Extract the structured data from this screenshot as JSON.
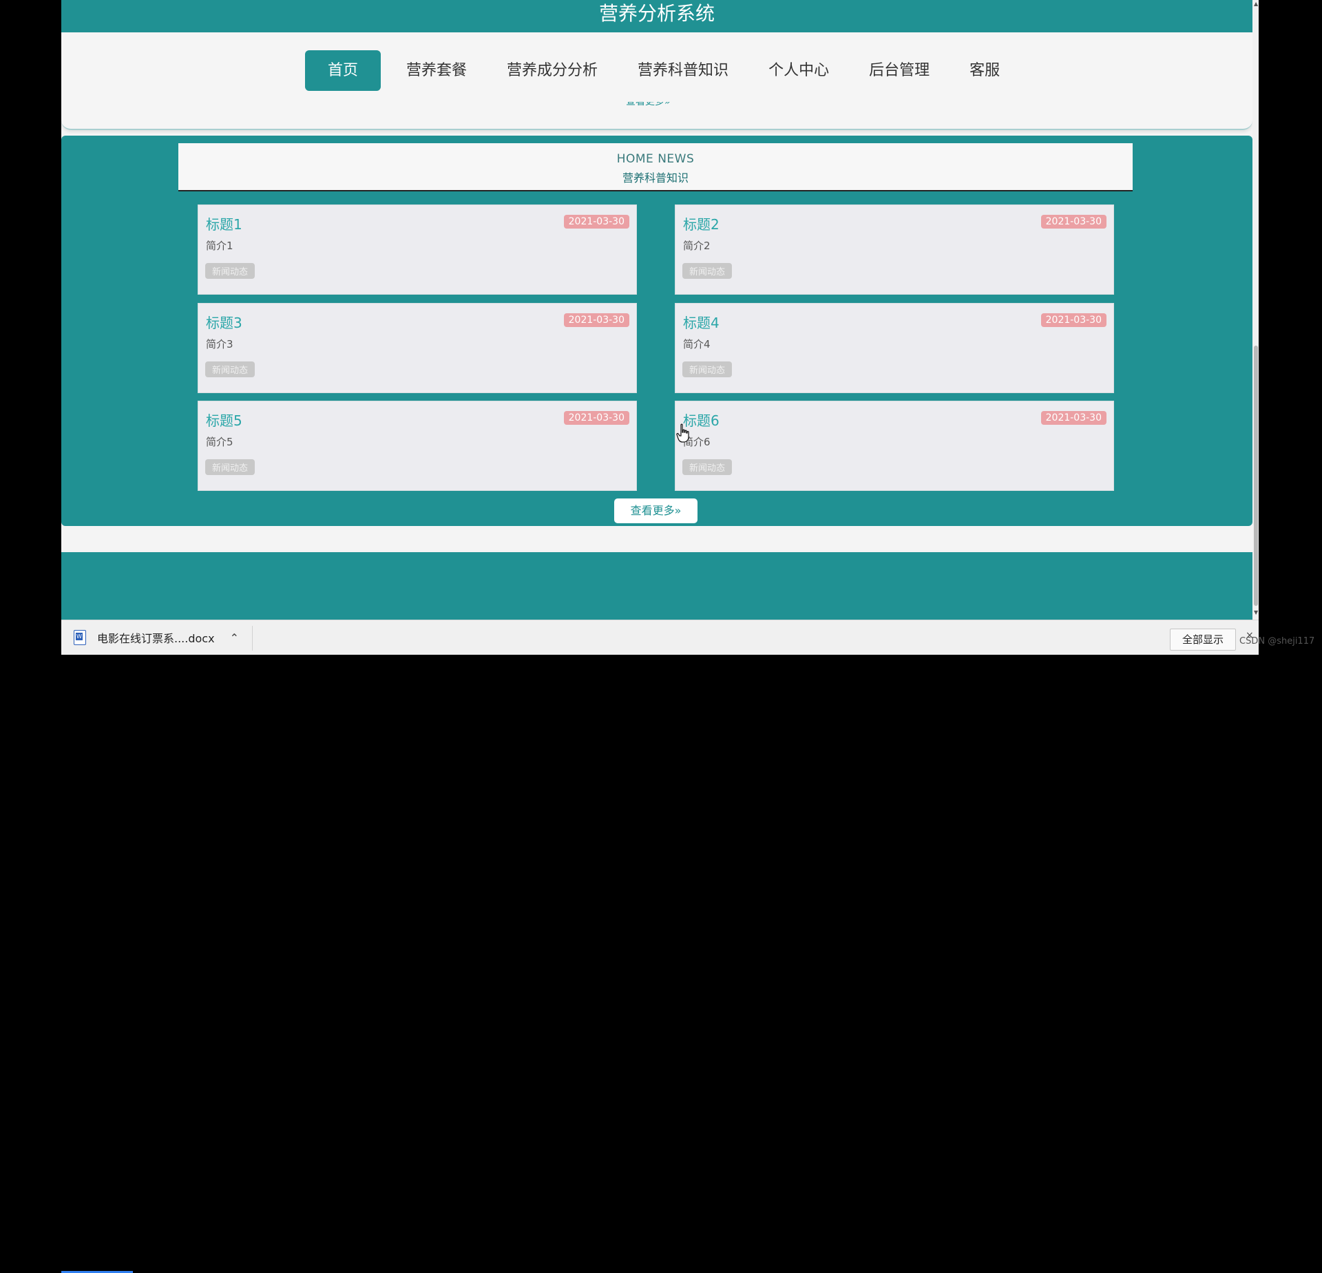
{
  "site": {
    "title": "营养分析系统"
  },
  "nav": {
    "items": [
      {
        "label": "首页",
        "active": true
      },
      {
        "label": "营养套餐"
      },
      {
        "label": "营养成分分析"
      },
      {
        "label": "营养科普知识"
      },
      {
        "label": "个人中心"
      },
      {
        "label": "后台管理"
      },
      {
        "label": "客服"
      }
    ],
    "partial_more": "查看更多»"
  },
  "news": {
    "header_en": "HOME NEWS",
    "header_cn": "营养科普知识",
    "cards": [
      {
        "title": "标题1",
        "date": "2021-03-30",
        "intro": "简介1",
        "tag": "新闻动态"
      },
      {
        "title": "标题2",
        "date": "2021-03-30",
        "intro": "简介2",
        "tag": "新闻动态"
      },
      {
        "title": "标题3",
        "date": "2021-03-30",
        "intro": "简介3",
        "tag": "新闻动态"
      },
      {
        "title": "标题4",
        "date": "2021-03-30",
        "intro": "简介4",
        "tag": "新闻动态"
      },
      {
        "title": "标题5",
        "date": "2021-03-30",
        "intro": "简介5",
        "tag": "新闻动态"
      },
      {
        "title": "标题6",
        "date": "2021-03-30",
        "intro": "简介6",
        "tag": "新闻动态"
      }
    ],
    "more_label": "查看更多»"
  },
  "download_bar": {
    "file_name": "电影在线订票系....docx",
    "show_all": "全部显示",
    "close": "×"
  },
  "watermark": "CSDN @sheji117",
  "colors": {
    "primary": "#209193",
    "date_badge": "#eba0a4",
    "tag_badge": "#c8c8c8",
    "title_text": "#2aa6a8"
  }
}
